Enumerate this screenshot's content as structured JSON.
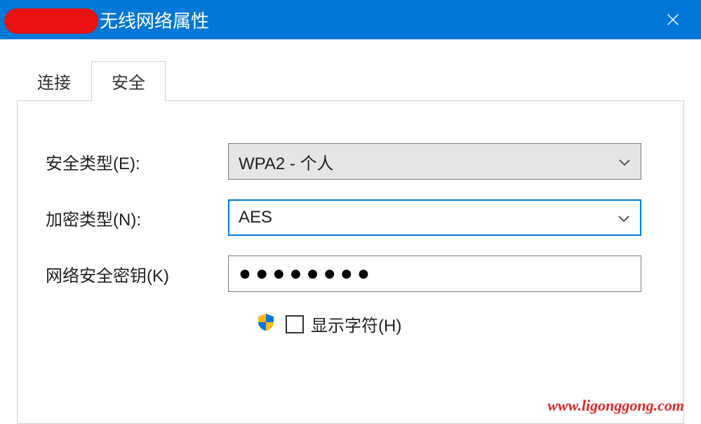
{
  "window": {
    "title": "无线网络属性"
  },
  "tabs": {
    "connect": "连接",
    "security": "安全"
  },
  "form": {
    "security_type_label": "安全类型(E):",
    "security_type_value": "WPA2 - 个人",
    "encryption_type_label": "加密类型(N):",
    "encryption_type_value": "AES",
    "network_key_label": "网络安全密钥(K)",
    "network_key_value": "●●●●●●●●",
    "show_chars_label": "显示字符(H)"
  },
  "watermark": "www.ligonggong.com"
}
